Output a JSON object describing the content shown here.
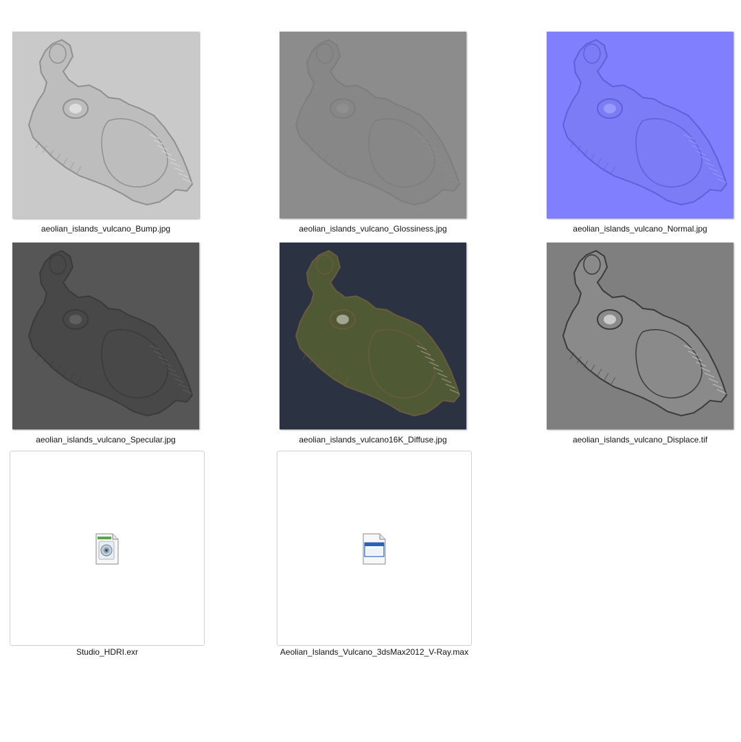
{
  "files": [
    {
      "name": "aeolian_islands_vulcano_Bump.jpg",
      "thumbnail": "bump-map-thumbnail",
      "colors": {
        "bg": "#c9c9c9",
        "island": "#bdbdbd",
        "edge": "#8f8f8f",
        "highlight": "#ececec"
      }
    },
    {
      "name": "aeolian_islands_vulcano_Glossiness.jpg",
      "thumbnail": "glossiness-map-thumbnail",
      "colors": {
        "bg": "#8c8c8c",
        "island": "#878787",
        "edge": "#7d7d7d",
        "highlight": "#939393"
      }
    },
    {
      "name": "aeolian_islands_vulcano_Normal.jpg",
      "thumbnail": "normal-map-thumbnail",
      "colors": {
        "bg": "#8080ff",
        "island": "#7c7cf6",
        "edge": "#5f5fd8",
        "highlight": "#a6a6ff"
      }
    },
    {
      "name": "aeolian_islands_vulcano_Specular.jpg",
      "thumbnail": "specular-map-thumbnail",
      "colors": {
        "bg": "#565656",
        "island": "#484848",
        "edge": "#3a3a3a",
        "highlight": "#6a6a6a"
      }
    },
    {
      "name": "aeolian_islands_vulcano16K_Diffuse.jpg",
      "thumbnail": "diffuse-map-thumbnail",
      "colors": {
        "bg": "#2b3242",
        "island": "#4f5a35",
        "edge": "#6b5a3e",
        "highlight": "#c9c4b6"
      }
    },
    {
      "name": "aeolian_islands_vulcano_Displace.tif",
      "thumbnail": "displacement-map-thumbnail",
      "colors": {
        "bg": "#7f7f7f",
        "island": "#8a8a8a",
        "edge": "#3a3a3a",
        "highlight": "#e6e6e6"
      }
    },
    {
      "name": "Studio_HDRI.exr",
      "icon": "exr-image-file-icon"
    },
    {
      "name": "Aeolian_Islands_Vulcano_3dsMax2012_V-Ray.max",
      "icon": "max-scene-file-icon"
    }
  ]
}
